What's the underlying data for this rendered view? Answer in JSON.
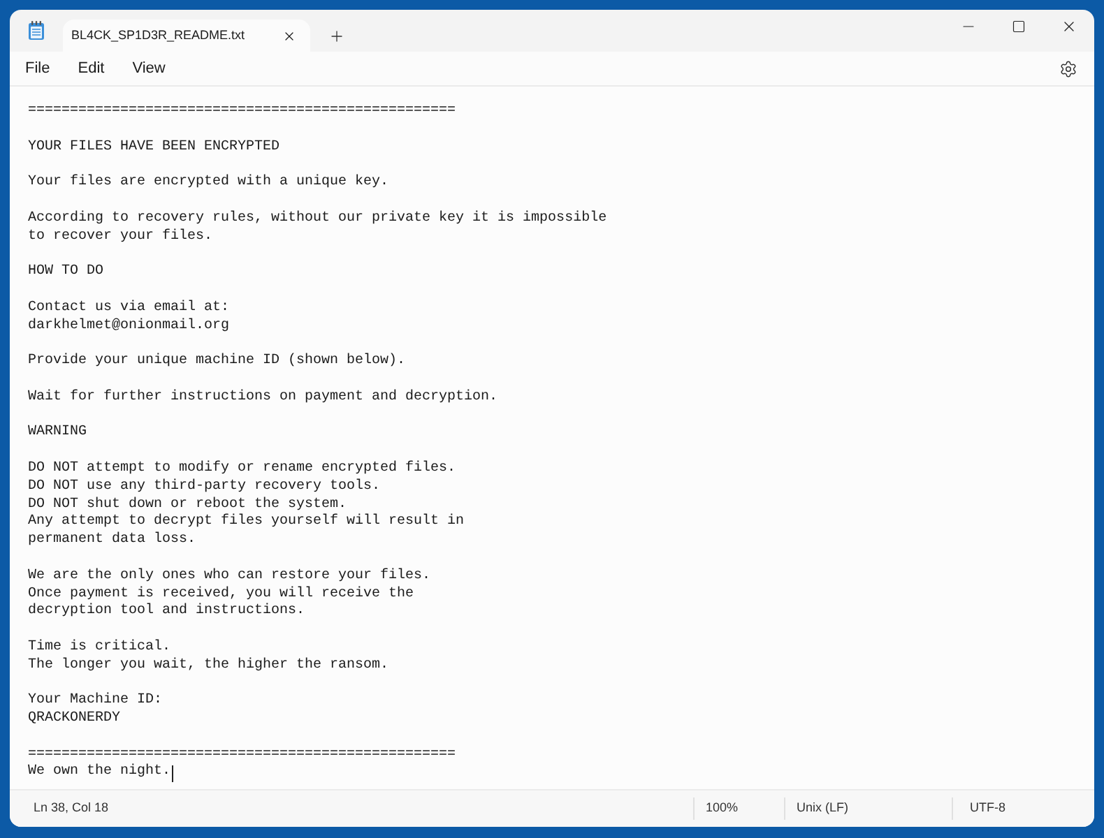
{
  "tabs": [
    {
      "title": "BL4CK_SP1D3R_README.txt",
      "selected": true
    }
  ],
  "menu": [
    "File",
    "Edit",
    "View"
  ],
  "document": {
    "paragraphs": [
      [
        "==================================================="
      ],
      [
        "YOUR FILES HAVE BEEN ENCRYPTED"
      ],
      [
        "Your files are encrypted with a unique key."
      ],
      [
        "According to recovery rules, without our private key it is impossible",
        "to recover your files."
      ],
      [
        "HOW TO DO"
      ],
      [
        "Contact us via email at:",
        "darkhelmet@onionmail.org"
      ],
      [
        "Provide your unique machine ID (shown below)."
      ],
      [
        "Wait for further instructions on payment and decryption."
      ],
      [
        "WARNING"
      ],
      [
        "DO NOT attempt to modify or rename encrypted files.",
        "DO NOT use any third-party recovery tools.",
        "DO NOT shut down or reboot the system.",
        "Any attempt to decrypt files yourself will result in",
        "permanent data loss."
      ],
      [
        "We are the only ones who can restore your files.",
        "Once payment is received, you will receive the",
        "decryption tool and instructions."
      ],
      [
        "Time is critical.",
        "The longer you wait, the higher the ransom."
      ],
      [
        "Your Machine ID:",
        "QRACKONERDY"
      ],
      [
        "===================================================",
        "We own the night."
      ]
    ]
  },
  "status_bar": {
    "position": "Ln 38, Col 18",
    "zoom": "100%",
    "line_ending": "Unix (LF)",
    "encoding": "UTF-8"
  }
}
